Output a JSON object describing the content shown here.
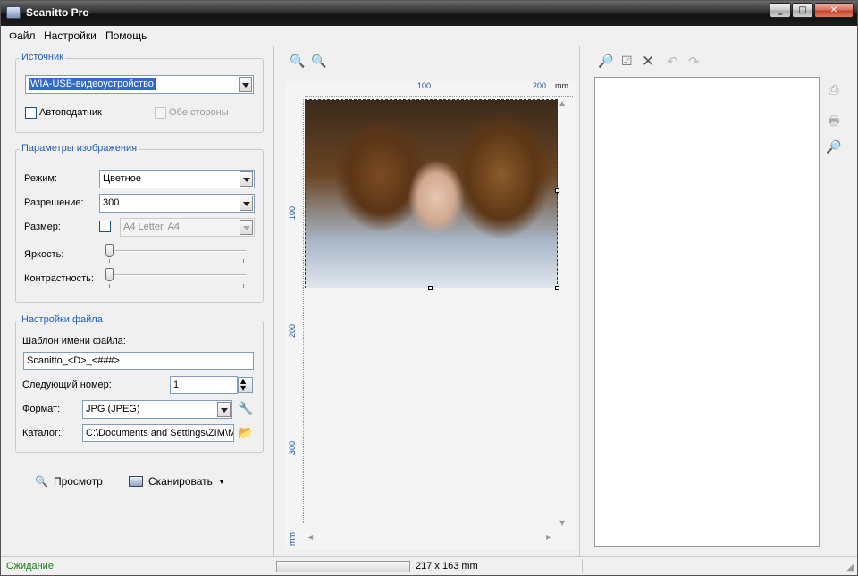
{
  "window": {
    "title": "Scanitto Pro",
    "controls": {
      "minimize": "_",
      "maximize": "□",
      "close": "✕"
    }
  },
  "menu": [
    "Файл",
    "Настройки",
    "Помощь"
  ],
  "source_group": {
    "legend": "Источник",
    "device": "WIA-USB-видеоустройство",
    "feeder_label": "Автоподатчик",
    "both_sides_label": "Обе стороны"
  },
  "image_group": {
    "legend": "Параметры изображения",
    "mode_label": "Режим:",
    "mode_value": "Цветное",
    "resolution_label": "Разрешение:",
    "resolution_value": "300",
    "size_label": "Размер:",
    "size_value": "A4 Letter, A4",
    "brightness_label": "Яркость:",
    "brightness_level": 0,
    "contrast_label": "Контрастность:",
    "contrast_level": 0
  },
  "file_group": {
    "legend": "Настройки файла",
    "template_label": "Шаблон имени файла:",
    "template_value": "Scanitto_<D>_<###>",
    "next_number_label": "Следующий номер:",
    "next_number_value": "1",
    "format_label": "Формат:",
    "format_value": "JPG (JPEG)",
    "folder_label": "Каталог:",
    "folder_value": "C:\\Documents and Settings\\ZIM\\Mc"
  },
  "actions": {
    "preview_label": "Просмотр",
    "scan_label": "Сканировать"
  },
  "preview": {
    "ruler_unit": "mm",
    "h_ticks": [
      "100",
      "200"
    ],
    "v_ticks": [
      "100",
      "200",
      "300"
    ]
  },
  "status": {
    "text": "Ожидание",
    "dimensions": "217 x 163 mm",
    "progress": 0
  },
  "colors": {
    "legend_blue": "#1f5fbf",
    "status_green": "#1b7a1b",
    "selection_blue": "#316ac5"
  }
}
